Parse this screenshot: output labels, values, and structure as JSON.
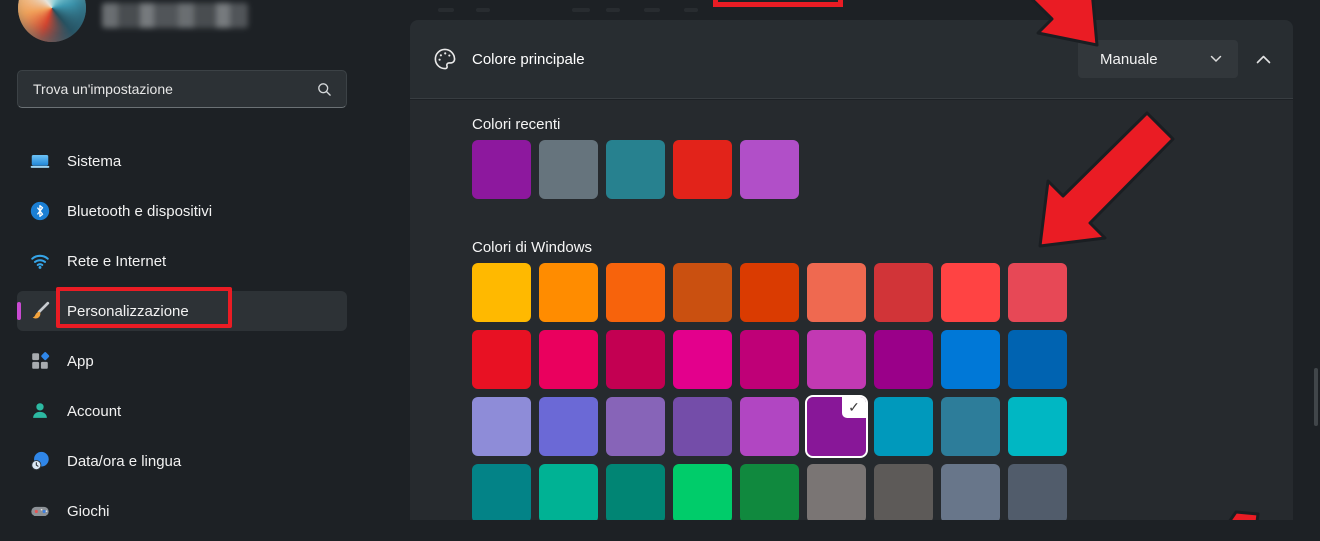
{
  "sidebar": {
    "search": {
      "placeholder": "Trova un'impostazione",
      "icon": "search-icon"
    },
    "accent_pill_color": "#C94AD2",
    "items": [
      {
        "label": "Sistema",
        "icon": "system-icon"
      },
      {
        "label": "Bluetooth e dispositivi",
        "icon": "bluetooth-icon"
      },
      {
        "label": "Rete e Internet",
        "icon": "network-icon"
      },
      {
        "label": "Personalizzazione",
        "icon": "personalization-icon",
        "selected": true
      },
      {
        "label": "App",
        "icon": "apps-icon"
      },
      {
        "label": "Account",
        "icon": "account-icon"
      },
      {
        "label": "Data/ora e lingua",
        "icon": "datetime-icon"
      },
      {
        "label": "Giochi",
        "icon": "games-icon"
      }
    ]
  },
  "main": {
    "header": {
      "title": "Colore principale",
      "icon": "palette-icon",
      "dropdown": {
        "value": "Manuale",
        "icon": "chevron-down-icon"
      },
      "collapse_icon": "chevron-up-icon"
    },
    "recent_colors": {
      "label": "Colori recenti",
      "swatches": [
        "#8D189E",
        "#66747D",
        "#27818F",
        "#E2231A",
        "#B14FC8"
      ]
    },
    "windows_colors": {
      "label": "Colori di Windows",
      "rows": [
        [
          "#FFB900",
          "#FF8C00",
          "#F7630C",
          "#CA5010",
          "#DA3B01",
          "#EF6950",
          "#D13438",
          "#FF4343",
          "#E74856"
        ],
        [
          "#E81123",
          "#EA005E",
          "#C30052",
          "#E3008C",
          "#BF0077",
          "#C239B3",
          "#9A0089",
          "#0078D7",
          "#0063B1"
        ],
        [
          "#8E8CD8",
          "#6B69D6",
          "#8764B8",
          "#744DA9",
          "#B146C2",
          "#881798",
          "#0099BC",
          "#2D7D9A",
          "#00B7C3"
        ],
        [
          "#038387",
          "#00B294",
          "#018574",
          "#00CC6A",
          "#10893E",
          "#7A7574",
          "#5D5A58",
          "#68768A",
          "#515C6B"
        ]
      ],
      "selected": {
        "row": 2,
        "col": 5,
        "check_glyph": "✓"
      }
    }
  },
  "annotations": {
    "highlight_color": "#EA1C24"
  }
}
